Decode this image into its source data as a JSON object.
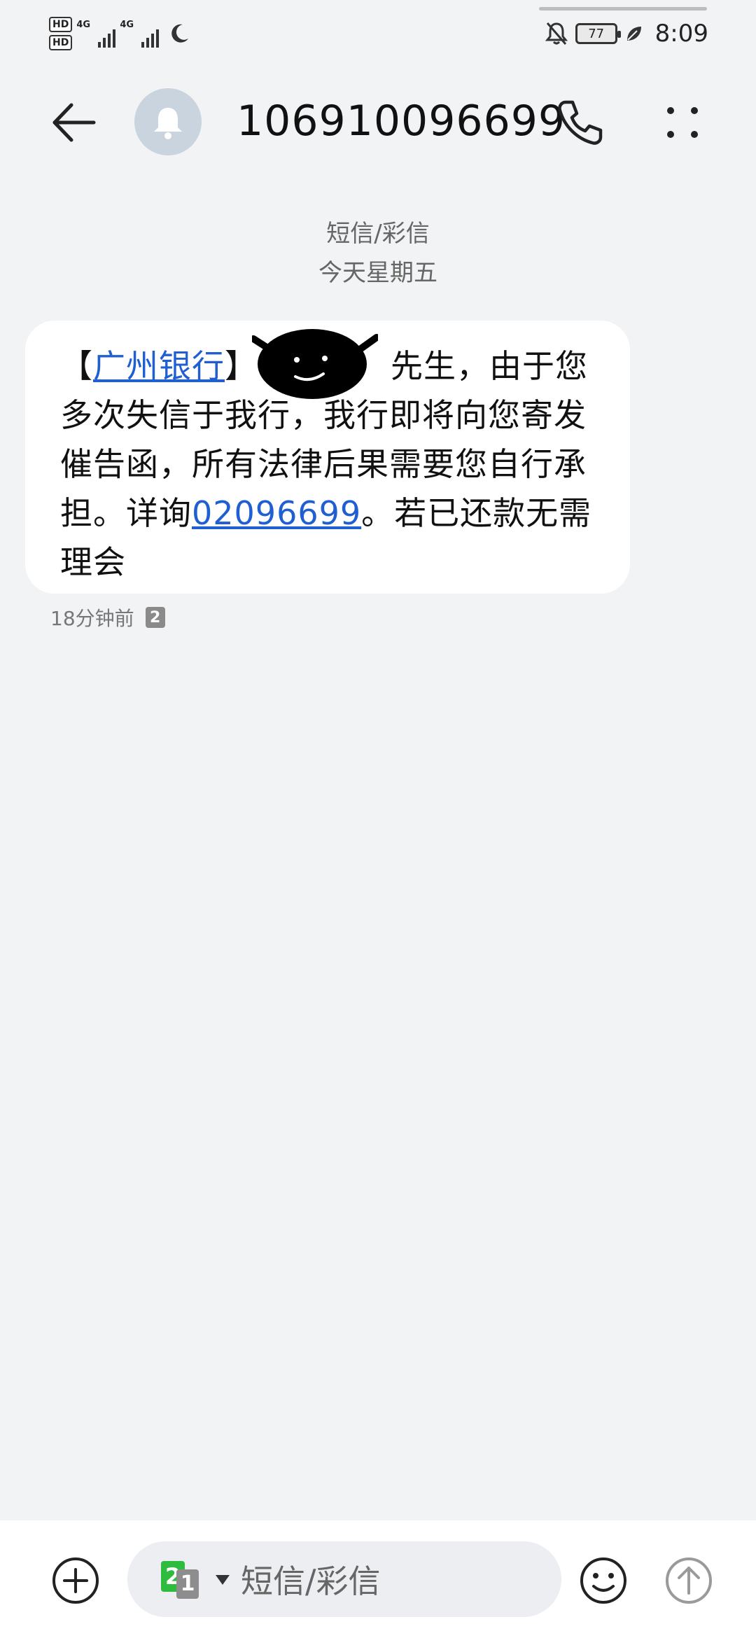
{
  "status_bar": {
    "hd1": "HD",
    "hd2": "HD",
    "net1": "4G",
    "net2": "4G",
    "battery": "77",
    "time": "8:09"
  },
  "header": {
    "title": "106910096699",
    "icons": [
      "back-arrow-icon",
      "bell-icon",
      "phone-icon",
      "more-icon"
    ]
  },
  "date_header": {
    "type_label": "短信/彩信",
    "day_label": "今天星期五"
  },
  "message": {
    "open_bracket": "【",
    "bank_link": "广州银行",
    "close_bracket": "】",
    "text_after_name": "先生，由于您多次失信于我行，我行即将向您寄发催告函，所有法律后果需要您自行承担。详询",
    "phone_link": "02096699",
    "text_end": "。若已还款无需理会",
    "time_ago": "18分钟前",
    "sim_badge": "2"
  },
  "input_bar": {
    "sim_primary": "2",
    "sim_secondary": "1",
    "placeholder": "短信/彩信"
  },
  "colors": {
    "background": "#f1f3f5",
    "bubble": "#ffffff",
    "link": "#1f5fd1",
    "sim_green": "#2ebc3f"
  }
}
